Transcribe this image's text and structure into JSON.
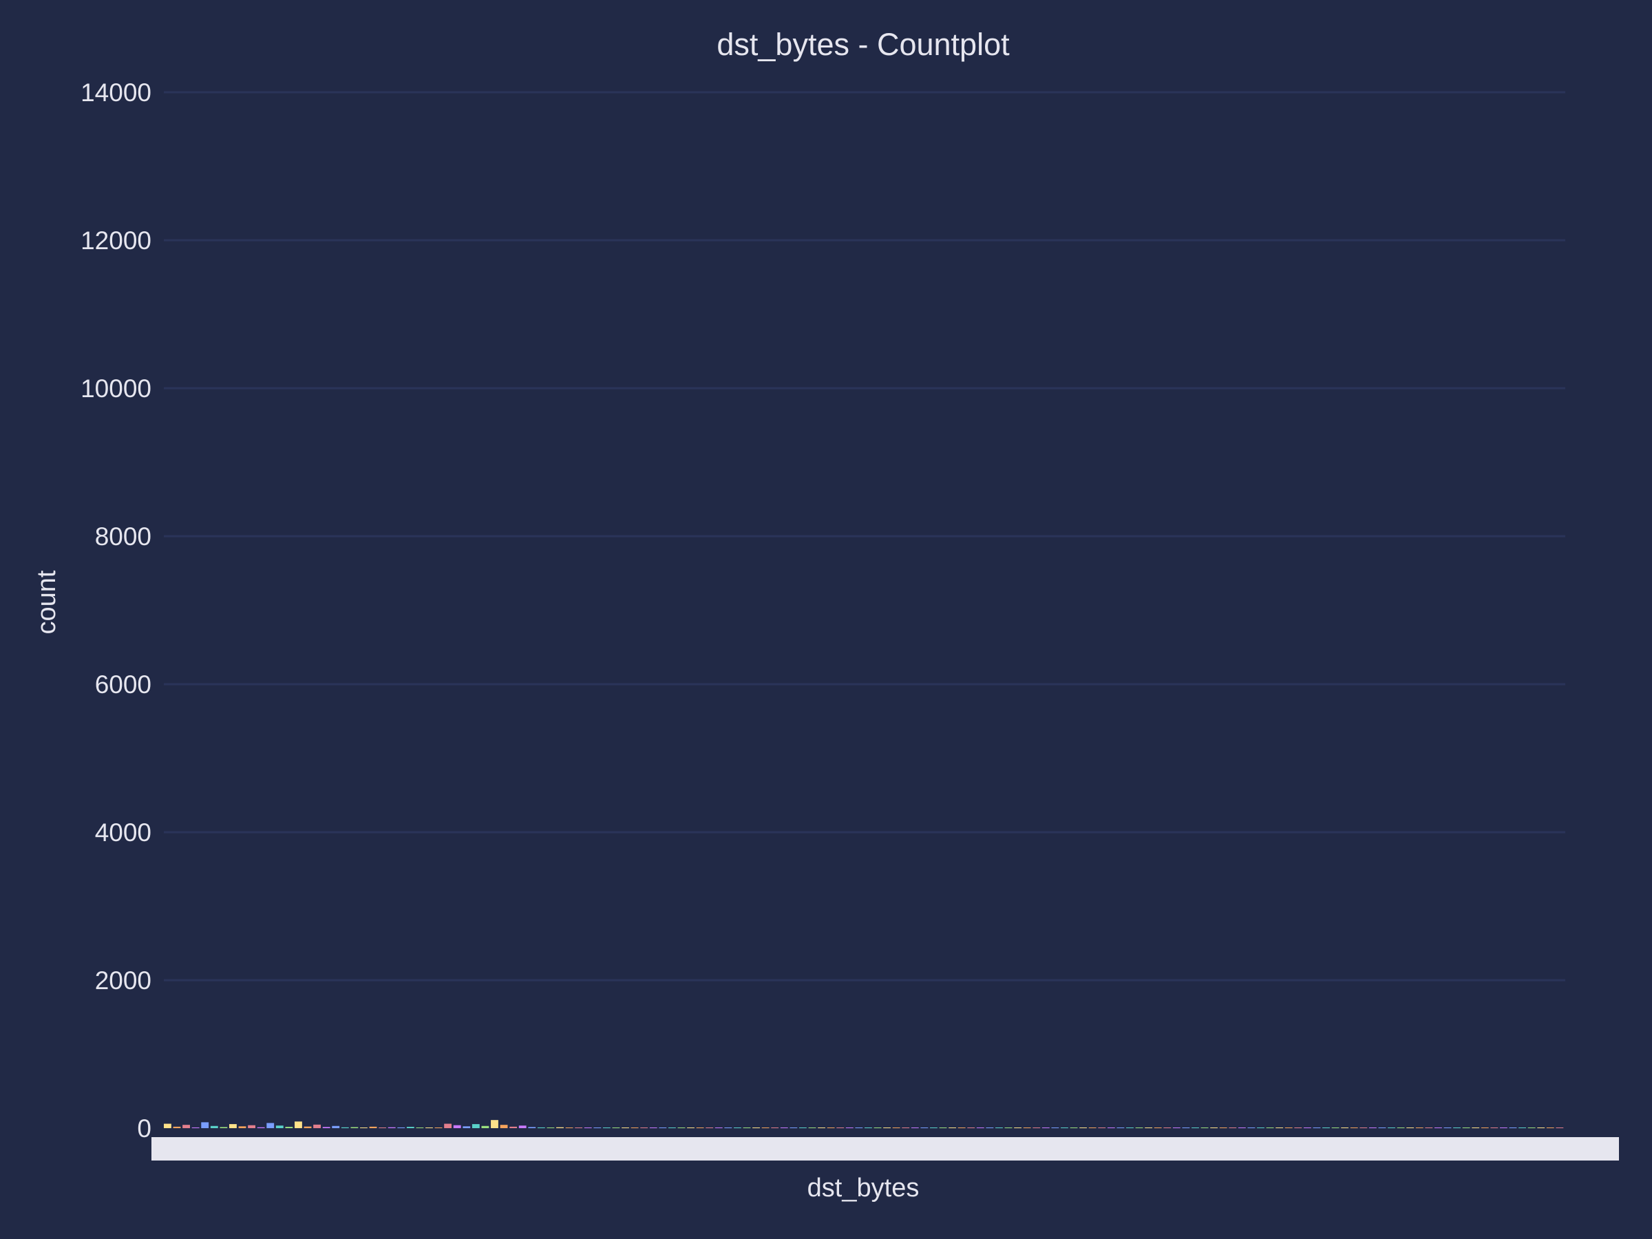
{
  "chart_data": {
    "type": "bar",
    "title": "dst_bytes - Countplot",
    "xlabel": "dst_bytes",
    "ylabel": "count",
    "ylim": [
      0,
      14000
    ],
    "yticks": [
      0,
      2000,
      4000,
      6000,
      8000,
      10000,
      12000,
      14000
    ],
    "grid": "horizontal",
    "x_tick_labels_overlapping": true,
    "series": [
      {
        "values": [
          60,
          20,
          45,
          10,
          80,
          30,
          15,
          55,
          25,
          40,
          12,
          70,
          35,
          18,
          90,
          22,
          48,
          16,
          30,
          11,
          14,
          8,
          20,
          6,
          12,
          10,
          18,
          5,
          9,
          7,
          60,
          40,
          25,
          55,
          30,
          110,
          45,
          20,
          35,
          15,
          10,
          8,
          12,
          6,
          9,
          5,
          7,
          4,
          6,
          3,
          5,
          4,
          6,
          3,
          8,
          2,
          4,
          3,
          5,
          2,
          3,
          2,
          4,
          1,
          3,
          2,
          2,
          1,
          3,
          1,
          2,
          1,
          2,
          1,
          1,
          2,
          1,
          1,
          2,
          1,
          5,
          1,
          1,
          3,
          1,
          1,
          4,
          1,
          1,
          2,
          1,
          1,
          6,
          1,
          1,
          2,
          1,
          1,
          3,
          1,
          1,
          1,
          2,
          1,
          1,
          8,
          1,
          1,
          2,
          1,
          1,
          3,
          1,
          1,
          2,
          1,
          1,
          4,
          1,
          1,
          2,
          1,
          1,
          1,
          2,
          1,
          1,
          3,
          1,
          1,
          2,
          1,
          1,
          1,
          2,
          1,
          1,
          1,
          1,
          2,
          1,
          1,
          1,
          1,
          2,
          1,
          1,
          1,
          1,
          1
        ]
      }
    ],
    "palette": [
      "#ffe28a",
      "#f5a35c",
      "#e27e8d",
      "#c879ff",
      "#7a9eff",
      "#5ad1c9",
      "#9adf7f"
    ]
  }
}
